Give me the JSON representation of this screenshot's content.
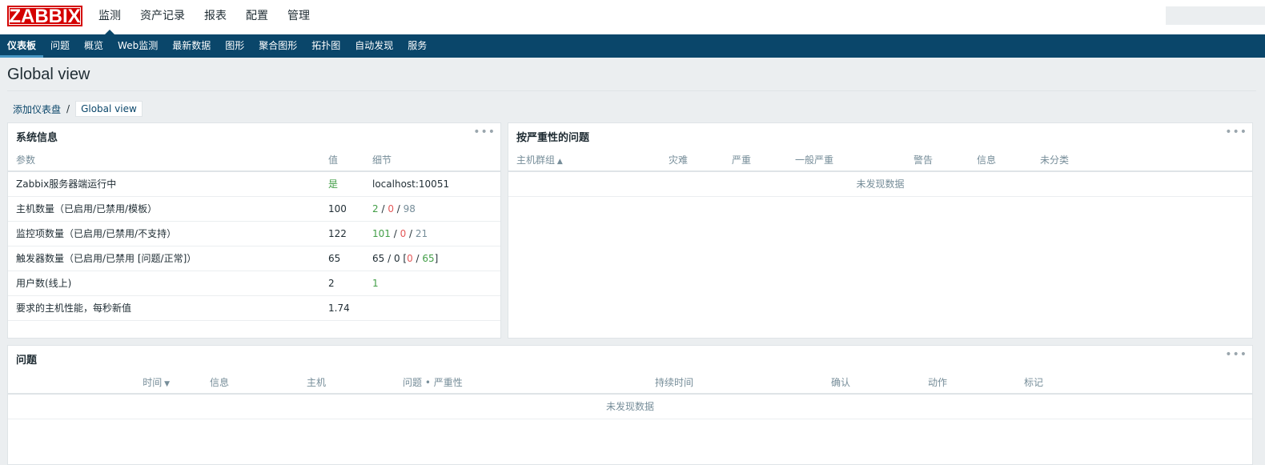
{
  "header": {
    "logo": "ZABBIX",
    "menu": [
      "监测",
      "资产记录",
      "报表",
      "配置",
      "管理"
    ],
    "active_menu": 0
  },
  "submenu": {
    "items": [
      "仪表板",
      "问题",
      "概览",
      "Web监测",
      "最新数据",
      "图形",
      "聚合图形",
      "拓扑图",
      "自动发现",
      "服务"
    ],
    "active": 0
  },
  "page": {
    "title": "Global view"
  },
  "breadcrumb": {
    "parent": "添加仪表盘",
    "separator": "/",
    "current": "Global view"
  },
  "system_info": {
    "title": "系统信息",
    "menu_glyph": "•••",
    "columns": [
      "参数",
      "值",
      "细节"
    ],
    "rows": [
      {
        "param": "Zabbix服务器端运行中",
        "value": "是",
        "details": {
          "text": "localhost:10051"
        }
      },
      {
        "param": "主机数量（已启用/已禁用/模板）",
        "value": "100",
        "details": {
          "a": "2",
          "s1": " / ",
          "b": "0",
          "s2": " / ",
          "c": "98"
        }
      },
      {
        "param": "监控项数量（已启用/已禁用/不支持）",
        "value": "122",
        "details": {
          "a": "101",
          "s1": " / ",
          "b": "0",
          "s2": " / ",
          "c": "21"
        }
      },
      {
        "param": "触发器数量（已启用/已禁用 [问题/正常]）",
        "value": "65",
        "details": {
          "pre": "65 / 0 [",
          "a": "0",
          "s1": " / ",
          "b": "65",
          "post": "]"
        }
      },
      {
        "param": "用户数(线上)",
        "value": "2",
        "details": {
          "a": "1"
        }
      },
      {
        "param": "要求的主机性能，每秒新值",
        "value": "1.74",
        "details": {
          "text": ""
        }
      }
    ]
  },
  "severity_widget": {
    "title": "按严重性的问题",
    "menu_glyph": "•••",
    "columns": [
      "主机群组",
      "灾难",
      "严重",
      "一般严重",
      "警告",
      "信息",
      "未分类"
    ],
    "no_data": "未发现数据"
  },
  "problems_widget": {
    "title": "问题",
    "menu_glyph": "•••",
    "columns": [
      "时间",
      "信息",
      "主机",
      "问题 • 严重性",
      "持续时间",
      "确认",
      "动作",
      "标记"
    ],
    "no_data": "未发现数据"
  },
  "colors": {
    "nav_bg": "#0a466a",
    "logo_red": "#d40000",
    "ok_green": "#429e47",
    "problem_red": "#e45959",
    "muted": "#768d99"
  }
}
